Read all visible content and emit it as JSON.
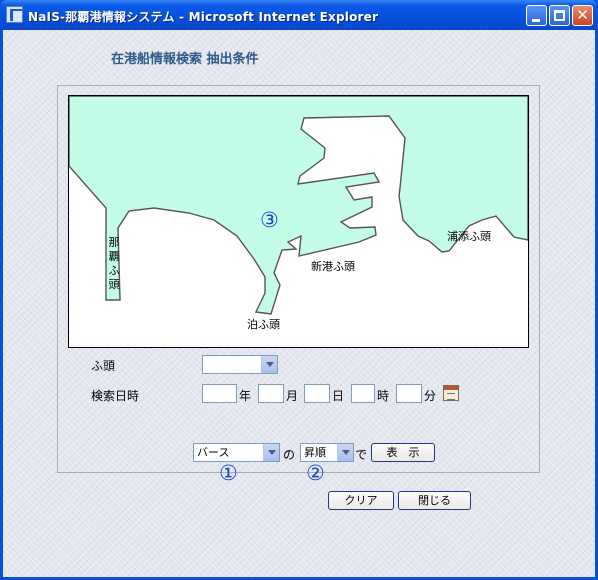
{
  "window": {
    "title": "NaIS-那覇港情報システム - Microsoft Internet Explorer"
  },
  "page": {
    "heading": "在港船情報検索 抽出条件"
  },
  "map": {
    "labels": {
      "naha_wharf": "那覇ふ頭",
      "shinko_wharf": "新港ふ頭",
      "urasoe_wharf": "浦添ふ頭",
      "tomari_wharf": "泊ふ頭"
    },
    "marker": "③",
    "colors": {
      "sea": "#c4fde7",
      "land": "#ffffff",
      "coast": "#555555"
    }
  },
  "form": {
    "wharf_label": "ふ頭",
    "wharf_value": "",
    "datetime_label": "検索日時",
    "units": {
      "year": "年",
      "month": "月",
      "day": "日",
      "hour": "時",
      "minute": "分"
    }
  },
  "sort": {
    "field_value": "バース",
    "connector": "の",
    "order_value": "昇順",
    "suffix": "で",
    "show_button": "表　示",
    "marker_field": "①",
    "marker_order": "②"
  },
  "actions": {
    "clear": "クリア",
    "close": "閉じる"
  }
}
